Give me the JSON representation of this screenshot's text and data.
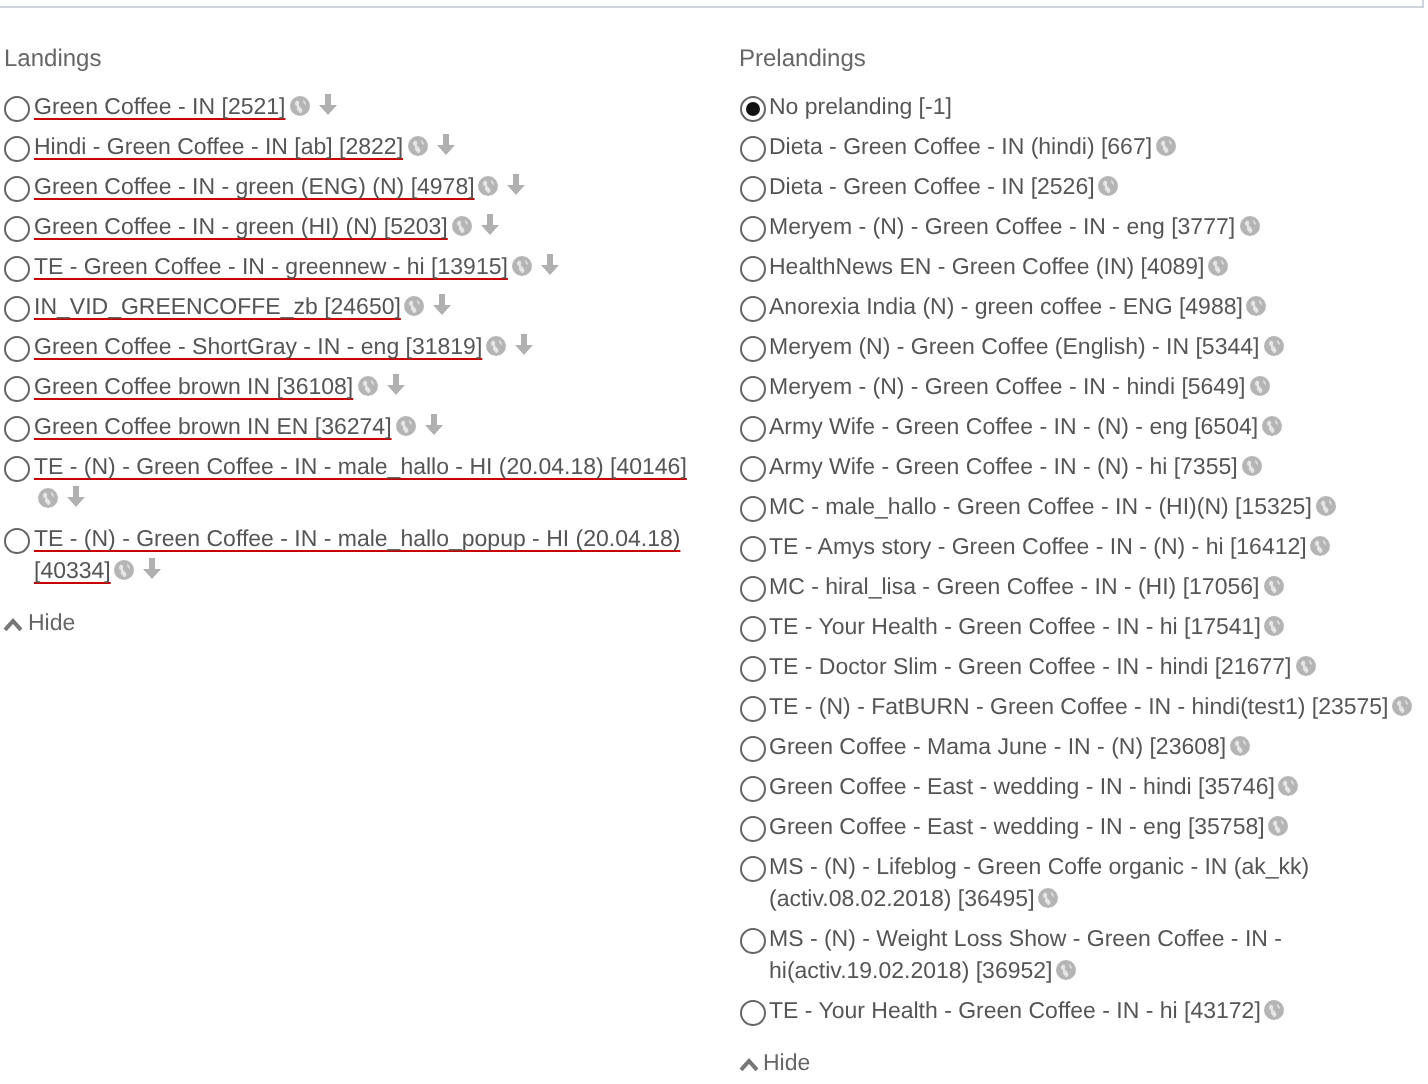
{
  "landings": {
    "title": "Landings",
    "items": [
      {
        "label": "Green Coffee - IN [2521]",
        "selected": false,
        "globe": true,
        "arrow": true
      },
      {
        "label": "Hindi - Green Coffee - IN [ab] [2822]",
        "selected": false,
        "globe": true,
        "arrow": true
      },
      {
        "label": "Green Coffee - IN - green (ENG) (N) [4978]",
        "selected": false,
        "globe": true,
        "arrow": true
      },
      {
        "label": "Green Coffee - IN - green (HI) (N) [5203]",
        "selected": false,
        "globe": true,
        "arrow": true
      },
      {
        "label": "TE - Green Coffee - IN - greennew - hi [13915]",
        "selected": false,
        "globe": true,
        "arrow": true
      },
      {
        "label": "IN_VID_GREENCOFFE_zb [24650]",
        "selected": false,
        "globe": true,
        "arrow": true
      },
      {
        "label": "Green Coffee - ShortGray - IN - eng [31819]",
        "selected": false,
        "globe": true,
        "arrow": true
      },
      {
        "label": "Green Coffee brown IN [36108]",
        "selected": false,
        "globe": true,
        "arrow": true
      },
      {
        "label": "Green Coffee brown IN EN [36274]",
        "selected": false,
        "globe": true,
        "arrow": true
      },
      {
        "label": "TE - (N) - Green Coffee - IN - male_hallo - HI (20.04.18) [40146]",
        "selected": false,
        "globe": true,
        "arrow": true
      },
      {
        "label": "TE - (N) - Green Coffee - IN - male_hallo_popup - HI (20.04.18) [40334]",
        "selected": false,
        "globe": true,
        "arrow": true
      }
    ],
    "hide": "Hide",
    "linked": true
  },
  "prelandings": {
    "title": "Prelandings",
    "items": [
      {
        "label": "No prelanding [-1]",
        "selected": true,
        "globe": false,
        "arrow": false
      },
      {
        "label": "Dieta - Green Coffee - IN (hindi) [667]",
        "selected": false,
        "globe": true,
        "arrow": false
      },
      {
        "label": "Dieta - Green Coffee - IN [2526]",
        "selected": false,
        "globe": true,
        "arrow": false
      },
      {
        "label": "Meryem - (N) - Green Coffee - IN - eng [3777]",
        "selected": false,
        "globe": true,
        "arrow": false
      },
      {
        "label": "HealthNews EN - Green Coffee (IN) [4089]",
        "selected": false,
        "globe": true,
        "arrow": false
      },
      {
        "label": "Anorexia India (N) - green coffee - ENG [4988]",
        "selected": false,
        "globe": true,
        "arrow": false
      },
      {
        "label": "Meryem (N) - Green Coffee (English) - IN [5344]",
        "selected": false,
        "globe": true,
        "arrow": false
      },
      {
        "label": "Meryem - (N) - Green Coffee - IN - hindi [5649]",
        "selected": false,
        "globe": true,
        "arrow": false
      },
      {
        "label": "Army Wife - Green Coffee - IN - (N) - eng [6504]",
        "selected": false,
        "globe": true,
        "arrow": false
      },
      {
        "label": "Army Wife - Green Coffee - IN - (N) - hi [7355]",
        "selected": false,
        "globe": true,
        "arrow": false
      },
      {
        "label": "MC - male_hallo - Green Coffee - IN - (HI)(N) [15325]",
        "selected": false,
        "globe": true,
        "arrow": false
      },
      {
        "label": "TE - Amys story - Green Coffee - IN - (N) - hi [16412]",
        "selected": false,
        "globe": true,
        "arrow": false
      },
      {
        "label": "MC - hiral_lisa - Green Coffee - IN - (HI) [17056]",
        "selected": false,
        "globe": true,
        "arrow": false
      },
      {
        "label": "TE - Your Health - Green Coffee - IN - hi [17541]",
        "selected": false,
        "globe": true,
        "arrow": false
      },
      {
        "label": "TE - Doctor Slim - Green Coffee - IN - hindi [21677]",
        "selected": false,
        "globe": true,
        "arrow": false
      },
      {
        "label": "TE - (N) - FatBURN - Green Coffee - IN - hindi(test1) [23575]",
        "selected": false,
        "globe": true,
        "arrow": false
      },
      {
        "label": "Green Coffee - Mama June - IN - (N) [23608]",
        "selected": false,
        "globe": true,
        "arrow": false
      },
      {
        "label": "Green Coffee - East - wedding - IN - hindi [35746]",
        "selected": false,
        "globe": true,
        "arrow": false
      },
      {
        "label": "Green Coffee - East - wedding - IN - eng [35758]",
        "selected": false,
        "globe": true,
        "arrow": false
      },
      {
        "label": "MS - (N) - Lifeblog - Green Coffe organic - IN (ak_kk) (activ.08.02.2018) [36495]",
        "selected": false,
        "globe": true,
        "arrow": false
      },
      {
        "label": "MS - (N) - Weight Loss Show - Green Coffee - IN - hi(activ.19.02.2018) [36952]",
        "selected": false,
        "globe": true,
        "arrow": false
      },
      {
        "label": "TE - Your Health - Green Coffee - IN - hi [43172]",
        "selected": false,
        "globe": true,
        "arrow": false
      }
    ],
    "hide": "Hide",
    "linked": false
  }
}
